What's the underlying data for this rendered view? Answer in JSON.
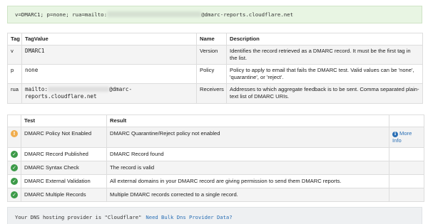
{
  "record": {
    "prefix": "v=DMARC1;  p=none; rua=mailto:",
    "suffix": "@dmarc-reports.cloudflare.net"
  },
  "tag_table": {
    "headers": [
      "Tag",
      "TagValue",
      "Name",
      "Description"
    ],
    "rows": [
      {
        "tag": "v",
        "value": "DMARC1",
        "name": "Version",
        "description": "Identifies the record retrieved as a DMARC record. It must be the first tag in the list."
      },
      {
        "tag": "p",
        "value": "none",
        "name": "Policy",
        "description": "Policy to apply to email that fails the DMARC test. Valid values can be 'none', 'quarantine', or 'reject'."
      },
      {
        "tag": "rua",
        "value_prefix": "mailto:",
        "value_suffix": "@dmarc-reports.cloudflare.net",
        "name": "Receivers",
        "description": "Addresses to which aggregate feedback is to be sent. Comma separated plain-text list of DMARC URIs."
      }
    ]
  },
  "test_table": {
    "headers": [
      "",
      "Test",
      "Result",
      ""
    ],
    "rows": [
      {
        "status": "warning",
        "icon": "warning-icon",
        "test": "DMARC Policy Not Enabled",
        "result": "DMARC Quarantine/Reject policy not enabled",
        "info": "More Info"
      },
      {
        "status": "pass",
        "icon": "check-icon",
        "test": "DMARC Record Published",
        "result": "DMARC Record found"
      },
      {
        "status": "pass",
        "icon": "check-icon",
        "test": "DMARC Syntax Check",
        "result": "The record is valid"
      },
      {
        "status": "pass",
        "icon": "check-icon",
        "test": "DMARC External Validation",
        "result": "All external domains in your DMARC record are giving permission to send them DMARC reports."
      },
      {
        "status": "pass",
        "icon": "check-icon",
        "test": "DMARC Multiple Records",
        "result": "Multiple DMARC records corrected to a single record."
      }
    ]
  },
  "provider": {
    "text": "Your DNS hosting provider is \"Cloudflare\"",
    "link": "Need Bulk Dns Provider Data?"
  },
  "colors": {
    "record_bg": "#e8f5e3",
    "warning": "#f0ad4e",
    "pass": "#3c9a48",
    "link": "#2a6fb5"
  }
}
